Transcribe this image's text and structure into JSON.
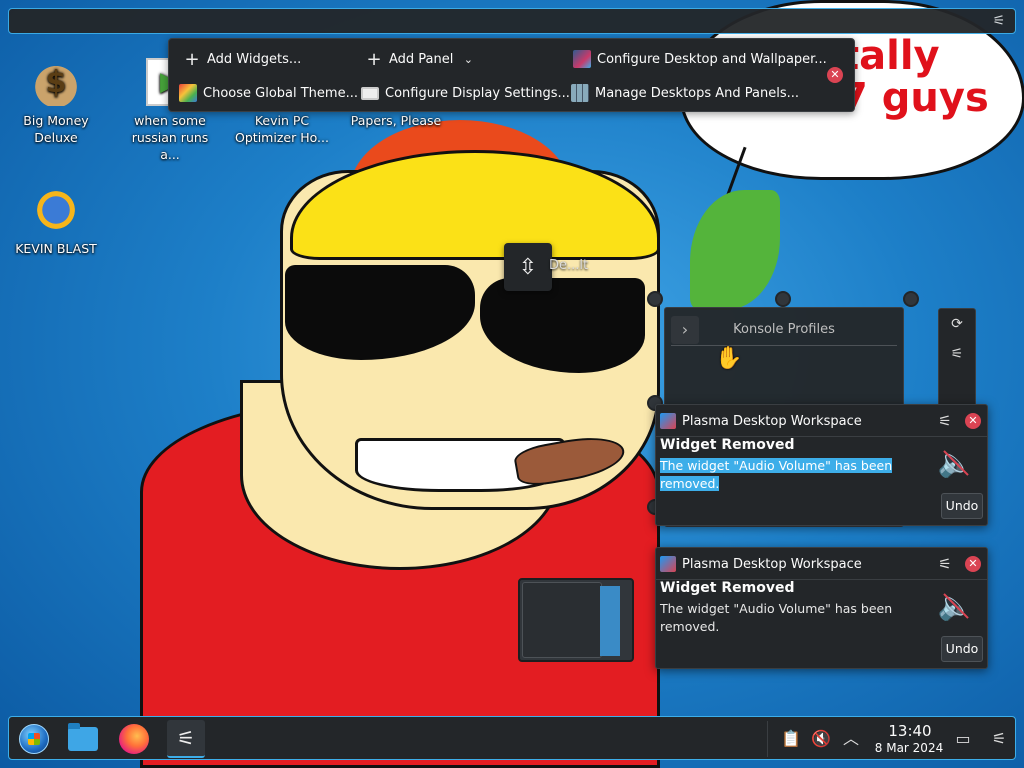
{
  "desktop": {
    "icons": [
      {
        "label": "Big Money Deluxe",
        "icon": "money-bag-icon"
      },
      {
        "label": "KEVIN BLAST",
        "icon": "sun-globe-icon"
      },
      {
        "label": "when some russian runs a...",
        "icon": "video-file-icon"
      },
      {
        "label": "Kevin PC Optimizer Ho...",
        "icon": "app-icon"
      },
      {
        "label": "Papers, Please",
        "icon": "app-icon"
      }
    ],
    "wallpaper_text": "tally\n7 guys"
  },
  "edit_toolbar": {
    "add_widgets": "Add Widgets...",
    "add_panel": "Add Panel",
    "configure_desktop": "Configure Desktop and Wallpaper...",
    "choose_global_theme": "Choose Global Theme...",
    "configure_display": "Configure Display Settings...",
    "manage_desktops": "Manage Desktops And Panels..."
  },
  "widget_placeholder": {
    "label": "De...lt"
  },
  "konsole_widget": {
    "title": "Konsole Profiles"
  },
  "notifications": [
    {
      "app": "Plasma Desktop Workspace",
      "title": "Widget Removed",
      "body": "The widget \"Audio Volume\" has been removed.",
      "action": "Undo",
      "selected": true
    },
    {
      "app": "Plasma Desktop Workspace",
      "title": "Widget Removed",
      "body": "The widget \"Audio Volume\" has been removed.",
      "action": "Undo",
      "selected": false
    }
  ],
  "taskbar": {
    "items": [
      "start-menu",
      "file-manager",
      "firefox",
      "audio-mixer"
    ],
    "time": "13:40",
    "date": "8 Mar 2024"
  },
  "colors": {
    "accent": "#3daee9",
    "panel_bg": "#232629",
    "close_red": "#da4453",
    "wallpaper_text": "#e0111b"
  }
}
